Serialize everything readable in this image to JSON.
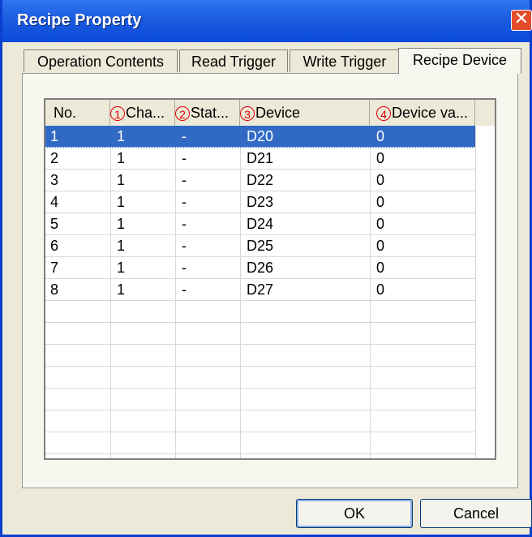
{
  "window": {
    "title": "Recipe Property",
    "close_glyph": "✕"
  },
  "tabs": [
    {
      "label": "Operation Contents",
      "active": false
    },
    {
      "label": "Read Trigger",
      "active": false
    },
    {
      "label": "Write Trigger",
      "active": false
    },
    {
      "label": "Recipe Device",
      "active": true
    }
  ],
  "columns": [
    {
      "marker": "",
      "label": "No."
    },
    {
      "marker": "1",
      "label": "Cha..."
    },
    {
      "marker": "2",
      "label": "Stat..."
    },
    {
      "marker": "3",
      "label": "Device"
    },
    {
      "marker": "4",
      "label": "Device va..."
    }
  ],
  "rows": [
    [
      "1",
      "1",
      "-",
      "D20",
      "0"
    ],
    [
      "2",
      "1",
      "-",
      "D21",
      "0"
    ],
    [
      "3",
      "1",
      "-",
      "D22",
      "0"
    ],
    [
      "4",
      "1",
      "-",
      "D23",
      "0"
    ],
    [
      "5",
      "1",
      "-",
      "D24",
      "0"
    ],
    [
      "6",
      "1",
      "-",
      "D25",
      "0"
    ],
    [
      "7",
      "1",
      "-",
      "D26",
      "0"
    ],
    [
      "8",
      "1",
      "-",
      "D27",
      "0"
    ]
  ],
  "selected_row": 0,
  "buttons": {
    "ok": "OK",
    "cancel": "Cancel"
  },
  "colors": {
    "titlebar": "#0a4ad8",
    "selection": "#316ac5",
    "marker": "#e00000",
    "close_button": "#e44d2b"
  }
}
